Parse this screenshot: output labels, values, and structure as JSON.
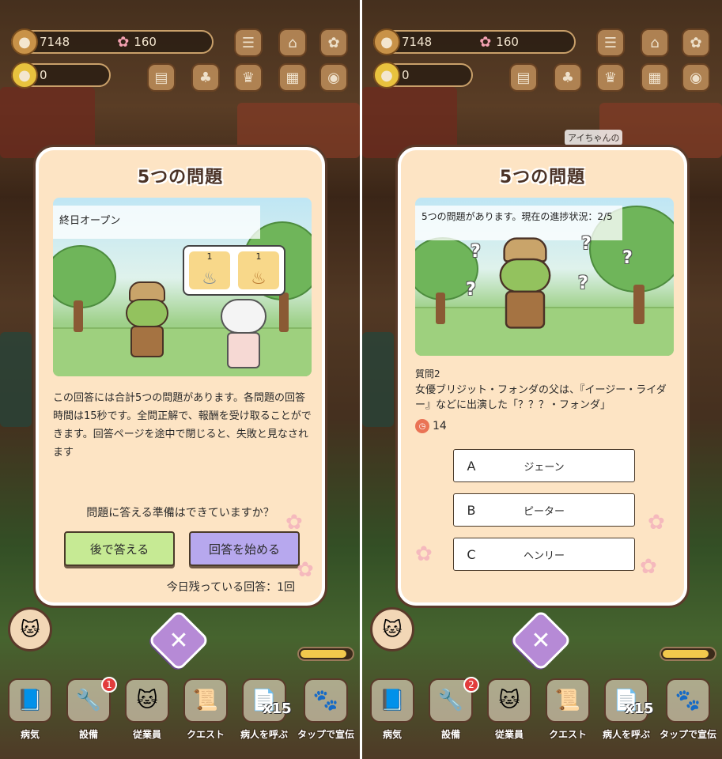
{
  "left": {
    "resources": {
      "acorns": "7148",
      "sakura": "160",
      "coins": "0"
    },
    "dialog": {
      "title": "5つの問題",
      "scene_banner": "終日オープン",
      "bubble": {
        "left_count": "1",
        "right_count": "1"
      },
      "description": "この回答には合計5つの問題があります。各問題の回答時間は15秒です。全問正解で、報酬を受け取ることができます。回答ページを途中で閉じると、失敗と見なされます",
      "ready_question": "問題に答える準備はできていますか？",
      "later_button": "後で答える",
      "start_button": "回答を始める",
      "remaining": "今日残っている回答：1回"
    },
    "bottom_nav": [
      {
        "label": "病気",
        "icon": "book-icon"
      },
      {
        "label": "設備",
        "icon": "tools-icon",
        "badge": "1"
      },
      {
        "label": "従業員",
        "icon": "cat-icon"
      },
      {
        "label": "クエスト",
        "icon": "quest-icon"
      },
      {
        "label": "病人を呼ぶ",
        "icon": "flyers-icon",
        "multiplier": "x15"
      },
      {
        "label": "タップで宣伝",
        "icon": "leaflet-icon"
      }
    ]
  },
  "right": {
    "resources": {
      "acorns": "7148",
      "sakura": "160",
      "coins": "0"
    },
    "side_chip": "アイちゃんの",
    "dialog": {
      "title": "5つの問題",
      "progress": "5つの問題があります。現在の進捗状況：2/5",
      "question_label": "質問2",
      "question_text": "女優ブリジット・フォンダの父は、『イージー・ライダー』などに出演した「？？？・フォンダ」",
      "timer": "14",
      "answers": [
        {
          "letter": "A",
          "text": "ジェーン"
        },
        {
          "letter": "B",
          "text": "ピーター"
        },
        {
          "letter": "C",
          "text": "ヘンリー"
        }
      ]
    },
    "bottom_nav": [
      {
        "label": "病気",
        "icon": "book-icon"
      },
      {
        "label": "設備",
        "icon": "tools-icon",
        "badge": "2"
      },
      {
        "label": "従業員",
        "icon": "cat-icon"
      },
      {
        "label": "クエスト",
        "icon": "quest-icon"
      },
      {
        "label": "病人を呼ぶ",
        "icon": "flyers-icon",
        "multiplier": "x15"
      },
      {
        "label": "タップで宣伝",
        "icon": "leaflet-icon"
      }
    ]
  },
  "colors": {
    "panel_bg": "#fde4c4",
    "later_btn": "#c6ea94",
    "start_btn": "#b7a8ee",
    "close_btn": "#b68ad6"
  }
}
